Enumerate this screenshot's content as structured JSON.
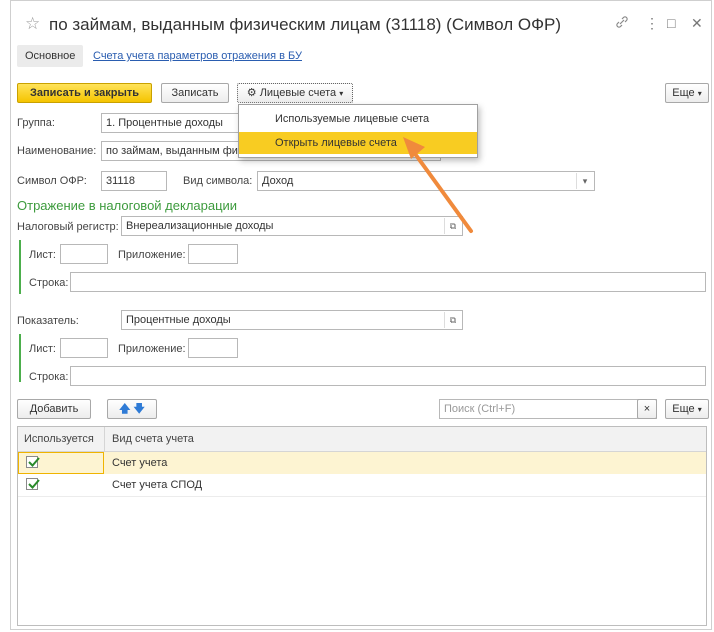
{
  "window": {
    "title": "по займам, выданным физическим лицам (31118) (Символ ОФР)",
    "link_icon": "🔗",
    "more_icon": "⋮",
    "maximize_icon": "□",
    "close_icon": "✕"
  },
  "tabs": [
    {
      "label": "Основное",
      "active": true
    },
    {
      "label": "Счета учета параметров отражения в БУ",
      "active": false
    }
  ],
  "toolbar": {
    "save_close": "Записать и закрыть",
    "save": "Записать",
    "accounts": "Лицевые счета",
    "more": "Еще"
  },
  "dropdown_menu": {
    "items": [
      "Используемые лицевые счета",
      "Открыть лицевые счета"
    ],
    "highlighted_index": 1
  },
  "form": {
    "group_label": "Группа:",
    "group_value": "1. Процентные доходы",
    "name_label": "Наименование:",
    "name_value": "по займам, выданным физическим лицам",
    "symbol_label": "Символ ОФР:",
    "symbol_value": "31118",
    "symbol_kind_label": "Вид символа:",
    "symbol_kind_value": "Доход"
  },
  "tax": {
    "section_title": "Отражение в налоговой декларации",
    "register_label": "Налоговый регистр:",
    "register_value": "Внереализационные доходы",
    "sheet_label": "Лист:",
    "appendix_label": "Приложение:",
    "line_label": "Строка:"
  },
  "indicator": {
    "label": "Показатель:",
    "value": "Процентные доходы",
    "sheet_label": "Лист:",
    "appendix_label": "Приложение:",
    "line_label": "Строка:"
  },
  "list_toolbar": {
    "add": "Добавить",
    "search_placeholder": "Поиск (Ctrl+F)",
    "clear": "×",
    "more": "Еще"
  },
  "table": {
    "columns": [
      "Используется",
      "Вид счета учета"
    ],
    "rows": [
      {
        "used": true,
        "kind": "Счет учета"
      },
      {
        "used": true,
        "kind": "Счет учета СПОД"
      }
    ]
  },
  "colors": {
    "primary_button": "#f5c400",
    "menu_highlight": "#f8cc22",
    "selected_row": "#fdf4d2",
    "section_green": "#3d9b3d",
    "arrow": "#f08a3c"
  }
}
